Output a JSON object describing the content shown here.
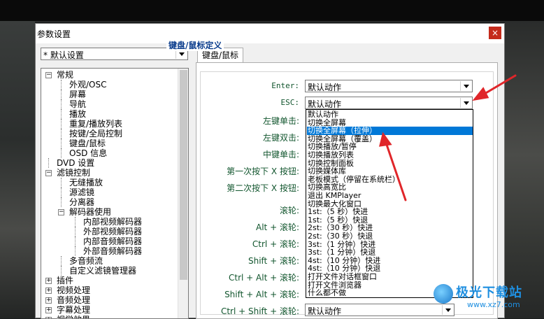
{
  "window": {
    "title": "参数设置",
    "close_glyph": "×"
  },
  "preset": {
    "value": "* 默认设置"
  },
  "tree": [
    {
      "label": "常规",
      "level": 0,
      "expander": "−"
    },
    {
      "label": "外观/OSC",
      "level": 1
    },
    {
      "label": "屏幕",
      "level": 1
    },
    {
      "label": "导航",
      "level": 1
    },
    {
      "label": "播放",
      "level": 1
    },
    {
      "label": "重复/播放列表",
      "level": 1
    },
    {
      "label": "按键/全局控制",
      "level": 1
    },
    {
      "label": "键盘/鼠标",
      "level": 1
    },
    {
      "label": "OSD 信息",
      "level": 1
    },
    {
      "label": "DVD 设置",
      "level": 0
    },
    {
      "label": "滤镜控制",
      "level": 0,
      "expander": "−"
    },
    {
      "label": "无缝播放",
      "level": 1
    },
    {
      "label": "源滤镜",
      "level": 1
    },
    {
      "label": "分离器",
      "level": 1
    },
    {
      "label": "解码器使用",
      "level": 1,
      "expander": "−"
    },
    {
      "label": "内部视频解码器",
      "level": 2
    },
    {
      "label": "外部视频解码器",
      "level": 2
    },
    {
      "label": "内部音频解码器",
      "level": 2
    },
    {
      "label": "外部音频解码器",
      "level": 2
    },
    {
      "label": "多音频流",
      "level": 1
    },
    {
      "label": "自定义滤镜管理器",
      "level": 1
    },
    {
      "label": "插件",
      "level": 0,
      "expander": "+"
    },
    {
      "label": "视频处理",
      "level": 0,
      "expander": "+"
    },
    {
      "label": "音频处理",
      "level": 0,
      "expander": "+"
    },
    {
      "label": "字幕处理",
      "level": 0,
      "expander": "+"
    },
    {
      "label": "视觉效果",
      "level": 0,
      "expander": "+"
    }
  ],
  "tab": {
    "label": "键盘/鼠标"
  },
  "group": {
    "title": "键盘/鼠标定义"
  },
  "rows": [
    {
      "label": "Enter:",
      "mono": true,
      "value": "默认动作"
    },
    {
      "label": "ESC:",
      "mono": true,
      "value": "默认动作"
    },
    {
      "label": "左键单击:",
      "mono": false
    },
    {
      "label": "左键双击:",
      "mono": false
    },
    {
      "label": "中键单击:",
      "mono": false
    },
    {
      "label": "第一次按下 X 按钮:",
      "mono": false
    },
    {
      "label": "第二次按下 X 按钮:",
      "mono": false
    },
    {
      "label": "滚轮:",
      "mono": false
    },
    {
      "label": "Alt + 滚轮:",
      "mono": false
    },
    {
      "label": "Ctrl + 滚轮:",
      "mono": false
    },
    {
      "label": "Shift + 滚轮:",
      "mono": false
    },
    {
      "label": "Ctrl + Alt + 滚轮:",
      "mono": false
    },
    {
      "label": "Shift + Alt + 滚轮:",
      "mono": false
    },
    {
      "label": "Ctrl + Shift + 滚轮:",
      "mono": false,
      "value": "默认动作"
    }
  ],
  "dropdown_options": [
    "默认动作",
    "切换全屏幕",
    "切换全屏幕（拉伸）",
    "切换全屏幕（覆盖）",
    "切换播放/暂停",
    "切换播放列表",
    "切换控制面板",
    "切换媒体库",
    "老板模式（停留在系统栏）",
    "切换高宽比",
    "退出 KMPlayer",
    "切换最大化窗口",
    "1st:（5 秒）快进",
    "1st:（5 秒）快退",
    "2st:（30 秒）快进",
    "2st:（30 秒）快退",
    "3st:（1 分钟）快进",
    "3st:（1 分钟）快退",
    "4st:（10 分钟）快进",
    "4st:（10 分钟）快退",
    "打开文件对话框窗口",
    "打开文件浏览器",
    "什么都不做"
  ],
  "selected_option_index": 2,
  "watermark": {
    "name": "极光下载站",
    "url": "www.xz7.com"
  },
  "colors": {
    "accent": "#0078d7",
    "annotation": "#e0262a",
    "label": "#12562e",
    "group_title": "#0a3c8c"
  }
}
